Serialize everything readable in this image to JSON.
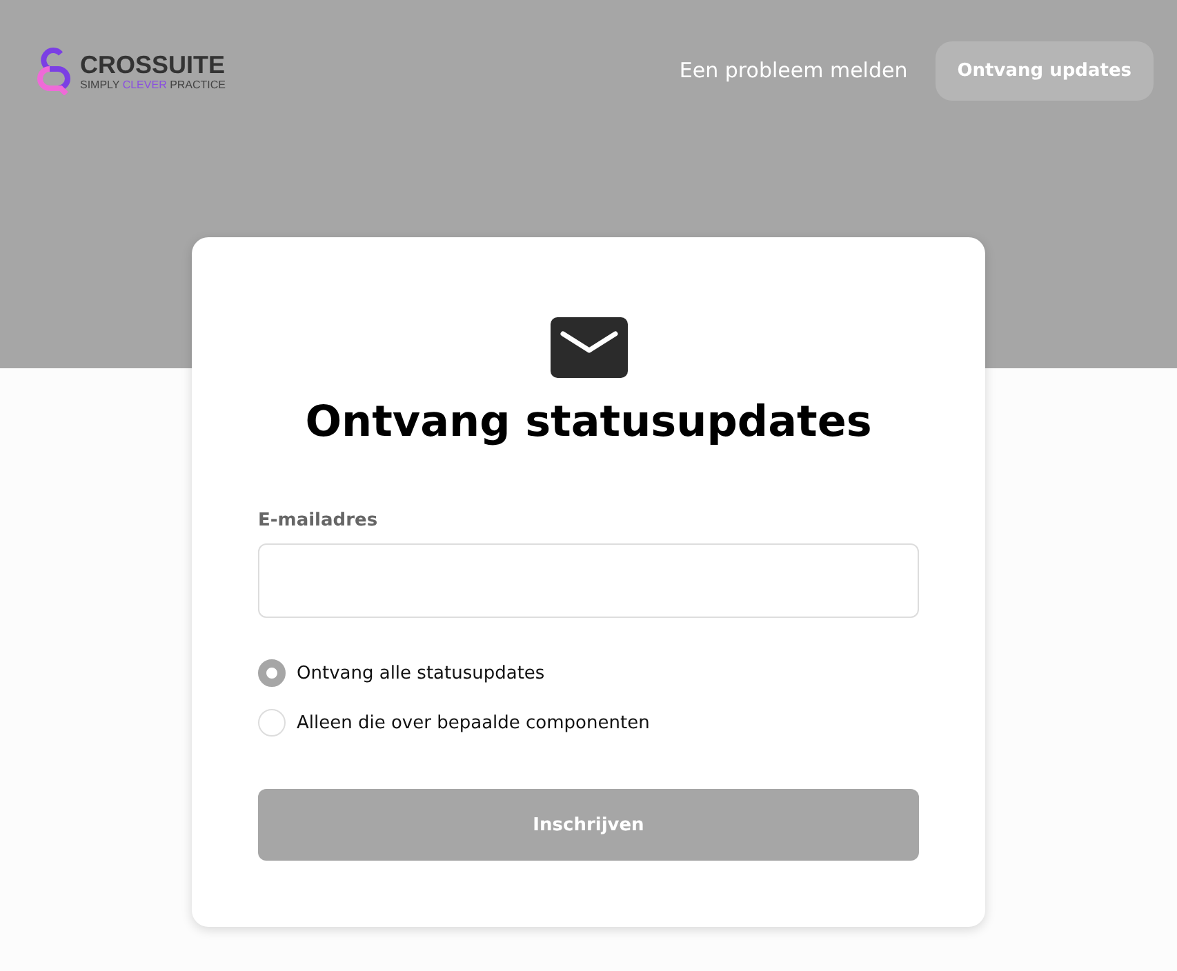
{
  "header": {
    "logo": {
      "name": "CROSSUITE",
      "tagline_parts": [
        {
          "text": "SIMPLY ",
          "accent": false
        },
        {
          "text": "CLEVER",
          "accent": true
        },
        {
          "text": " PRACTICE",
          "accent": false
        }
      ]
    },
    "links": [
      {
        "label": "Een probleem melden",
        "kind": "link"
      },
      {
        "label": "Ontvang updates",
        "kind": "button"
      }
    ]
  },
  "card": {
    "title": "Ontvang statusupdates",
    "email": {
      "label": "E-mailadres"
    },
    "options": [
      {
        "label": "Ontvang alle statusupdates",
        "selected": true
      },
      {
        "label": "Alleen die over bepaalde componenten",
        "selected": false
      }
    ],
    "submit": {
      "label": "Inschrijven",
      "disabled": true
    }
  }
}
